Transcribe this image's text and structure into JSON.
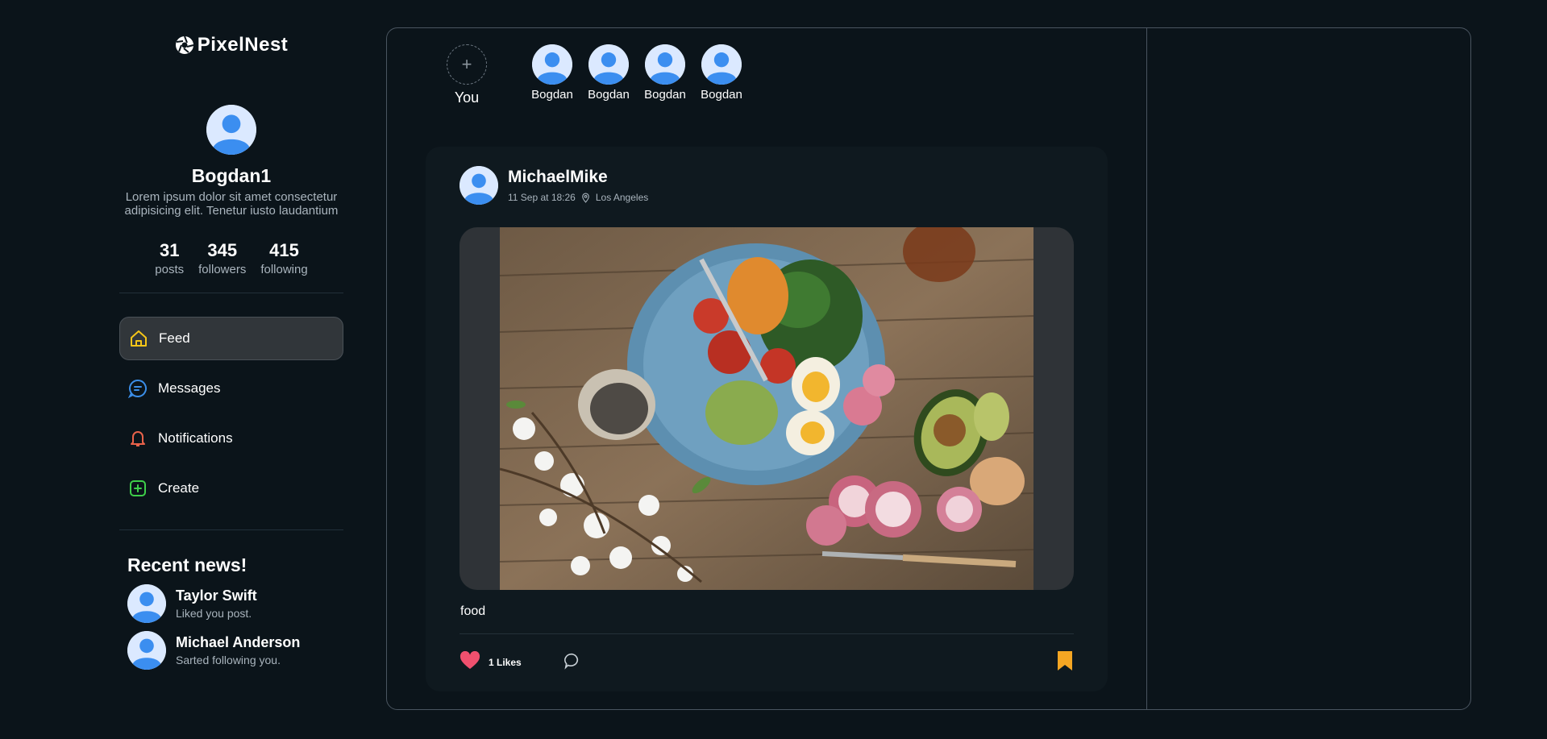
{
  "app": {
    "name": "PixelNest"
  },
  "profile": {
    "name": "Bogdan1",
    "bio": "Lorem ipsum dolor sit amet consectetur adipisicing elit. Tenetur iusto laudantium",
    "stats": [
      {
        "value": "31",
        "label": "posts"
      },
      {
        "value": "345",
        "label": "followers"
      },
      {
        "value": "415",
        "label": "following"
      }
    ]
  },
  "nav": [
    {
      "label": "Feed",
      "icon": "home-icon",
      "color": "#f5c518",
      "active": true
    },
    {
      "label": "Messages",
      "icon": "chat-icon",
      "color": "#3b8ee8",
      "active": false
    },
    {
      "label": "Notifications",
      "icon": "bell-icon",
      "color": "#e8624a",
      "active": false
    },
    {
      "label": "Create",
      "icon": "plus-square-icon",
      "color": "#3ecf4a",
      "active": false
    }
  ],
  "news": {
    "title": "Recent news!",
    "items": [
      {
        "name": "Taylor Swift",
        "text": "Liked you post."
      },
      {
        "name": "Michael Anderson",
        "text": "Sarted following you."
      }
    ]
  },
  "stories": {
    "add_label": "You",
    "items": [
      {
        "name": "Bogdan"
      },
      {
        "name": "Bogdan"
      },
      {
        "name": "Bogdan"
      },
      {
        "name": "Bogdan"
      }
    ]
  },
  "post": {
    "author": "MichaelMike",
    "time": "11 Sep at 18:26",
    "location": "Los Angeles",
    "caption": "food",
    "likes": "1 Likes",
    "image_alt": "food plate photo"
  },
  "colors": {
    "background": "#0b141a",
    "card": "#0f191f",
    "like": "#f0506e",
    "bookmark": "#f5a623"
  }
}
